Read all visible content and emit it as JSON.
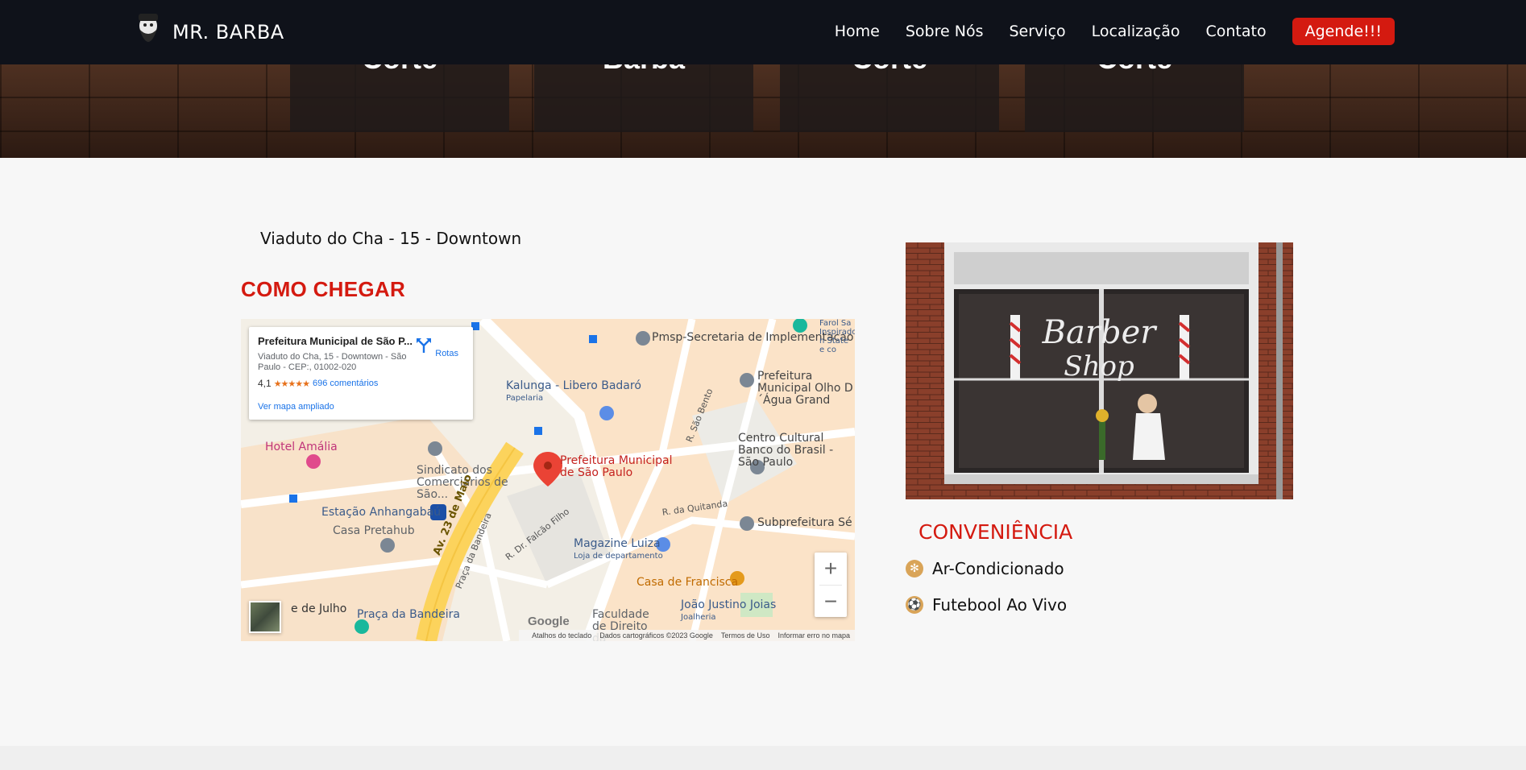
{
  "nav": {
    "brand": "MR. BARBA",
    "links": [
      "Home",
      "Sobre Nós",
      "Serviço",
      "Localização",
      "Contato"
    ],
    "cta": "Agende!!!"
  },
  "hero": {
    "cards": [
      "Corte",
      "Barba",
      "Corte",
      "Corte"
    ]
  },
  "location": {
    "address": "Viaduto do Cha - 15 - Downtown",
    "directions_title": "COMO CHEGAR"
  },
  "map": {
    "place_title": "Prefeitura Municipal de São P...",
    "place_address": "Viaduto do Cha, 15 - Downtown - São Paulo - CEP:, 01002-020",
    "rating": "4,1",
    "stars": "★★★★★",
    "reviews": "696 comentários",
    "larger_map": "Ver mapa ampliado",
    "directions": "Rotas",
    "zoom_in": "+",
    "zoom_out": "−",
    "google": "Google",
    "attribution": {
      "shortcuts": "Atalhos do teclado",
      "data": "Dados cartográficos ©2023 Google",
      "terms": "Termos de Uso",
      "report": "Informar erro no mapa"
    },
    "labels": {
      "pmsp": "Pmsp-Secretaria de Implementacao das...",
      "kalunga": "Kalunga - Libero Badaró",
      "kalunga_sub": "Papelaria",
      "prefeitura_olho": "Prefeitura Municipal Olho D´Água Grand",
      "farol": "Farol Sa Inspirado n State e co",
      "hotel": "Hotel Amália",
      "sindicato": "Sindicato dos Comerciários de São...",
      "marker": "Prefeitura Municipal de São Paulo",
      "centro_cultural": "Centro Cultural Banco do Brasil - São Paulo",
      "estacao": "Estação Anhangabaú",
      "casa_pretahub": "Casa Pretahub",
      "subprefeitura": "Subprefeitura Sé",
      "magazine": "Magazine Luiza",
      "magazine_sub": "Loja de departamento",
      "casa_francisca": "Casa de Francisca",
      "joao": "João Justino Joias",
      "joao_sub": "Joalheria",
      "faculdade": "Faculdade de Direito da",
      "praca": "Praça da Bandeira",
      "julho": "e de Julho",
      "av23": "Av. 23 de Maio",
      "praca_road": "Praça da Bandeira",
      "falcao": "R. Dr. Falcão Filho",
      "quitanda": "R. da Quitanda",
      "sao_bento": "R. São Bento"
    }
  },
  "convenience": {
    "title": "CONVENIÊNCIA",
    "items": [
      "Ar-Condicionado",
      "Futebool Ao Vivo"
    ]
  },
  "colors": {
    "brand_red": "#d41a10",
    "nav_bg": "#0f121a",
    "icon_gold": "#d9a458"
  }
}
